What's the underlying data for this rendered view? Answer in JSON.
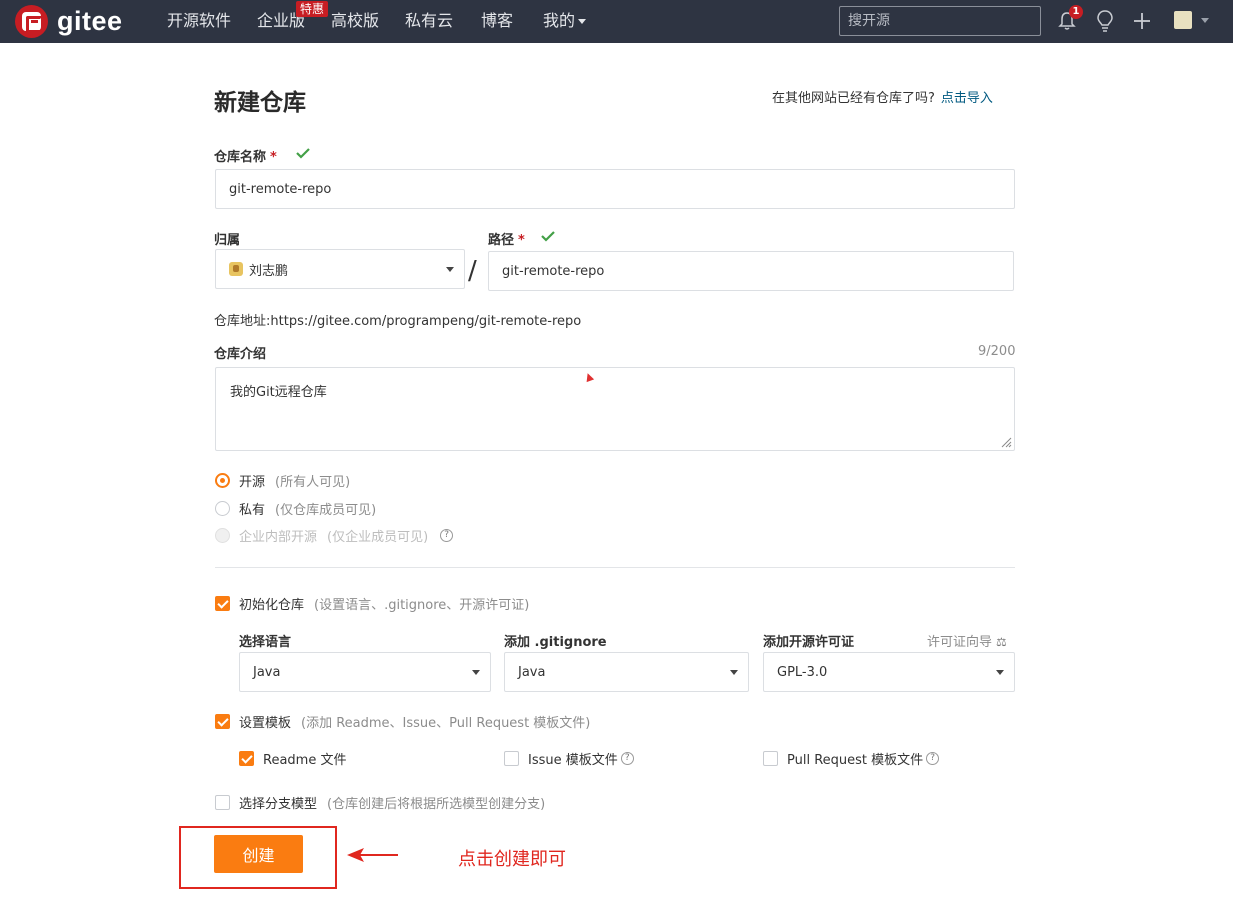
{
  "nav": {
    "logo_text": "gitee",
    "items": [
      "开源软件",
      "企业版",
      "高校版",
      "私有云",
      "博客",
      "我的"
    ],
    "badge": "特惠",
    "search_placeholder": "搜开源",
    "notification_count": "1"
  },
  "form": {
    "title": "新建仓库",
    "import_hint": "在其他网站已经有仓库了吗?",
    "import_link": "点击导入",
    "repo_name_label": "仓库名称",
    "repo_name_value": "git-remote-repo",
    "owner_label": "归属",
    "owner_value": "刘志鹏",
    "path_label": "路径",
    "path_value": "git-remote-repo",
    "required_mark": "*",
    "address_label": "仓库地址:",
    "address_value": "https://gitee.com/programpeng/git-remote-repo",
    "desc_label": "仓库介绍",
    "desc_counter": "9/200",
    "desc_value": "我的Git远程仓库",
    "visibility": {
      "public_label": "开源",
      "public_hint": "(所有人可见)",
      "private_label": "私有",
      "private_hint": "(仅仓库成员可见)",
      "internal_label": "企业内部开源",
      "internal_hint": "(仅企业成员可见)",
      "selected": "public"
    },
    "init": {
      "label": "初始化仓库",
      "hint": "(设置语言、.gitignore、开源许可证)",
      "checked": true,
      "language_label": "选择语言",
      "language_value": "Java",
      "gitignore_label": "添加 .gitignore",
      "gitignore_value": "Java",
      "license_label": "添加开源许可证",
      "license_value": "GPL-3.0",
      "license_guide": "许可证向导"
    },
    "template": {
      "label": "设置模板",
      "hint": "(添加 Readme、Issue、Pull Request 模板文件)",
      "checked": true,
      "readme_label": "Readme 文件",
      "readme_checked": true,
      "issue_label": "Issue 模板文件",
      "issue_checked": false,
      "pr_label": "Pull Request 模板文件",
      "pr_checked": false
    },
    "branch": {
      "label": "选择分支模型",
      "hint": "(仓库创建后将根据所选模型创建分支)",
      "checked": false
    },
    "create_button": "创建"
  },
  "annotation": {
    "text": "点击创建即可",
    "color": "#e0271f"
  },
  "colors": {
    "accent": "#fa7c11",
    "nav_bg": "#2e3442",
    "brand_red": "#c71d23"
  }
}
